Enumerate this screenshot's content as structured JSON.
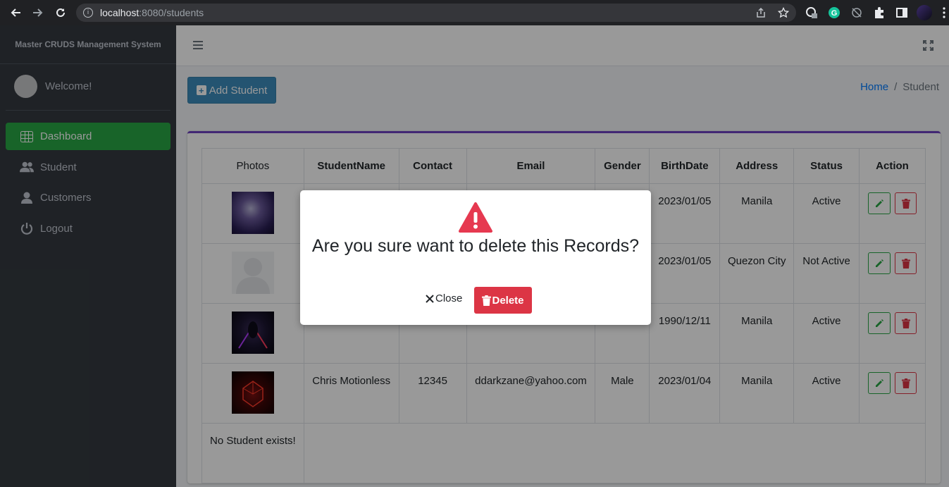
{
  "browser": {
    "url_host": "localhost",
    "url_rest": ":8080/students"
  },
  "sidebar": {
    "brand": "Master CRUDS Management System",
    "welcome": "Welcome!",
    "items": [
      {
        "label": "Dashboard",
        "icon": "table-icon",
        "active": true
      },
      {
        "label": "Student",
        "icon": "users-icon",
        "active": false
      },
      {
        "label": "Customers",
        "icon": "user-icon",
        "active": false
      },
      {
        "label": "Logout",
        "icon": "power-icon",
        "active": false
      }
    ]
  },
  "header": {
    "add_button": "Add Student",
    "breadcrumb_home": "Home",
    "breadcrumb_sep": "/",
    "breadcrumb_current": "Student"
  },
  "table": {
    "headers": [
      "Photos",
      "StudentName",
      "Contact",
      "Email",
      "Gender",
      "BirthDate",
      "Address",
      "Status",
      "Action"
    ],
    "rows": [
      {
        "photo": "dark-figure-photo",
        "name": "",
        "contact": "",
        "email": "",
        "gender": "",
        "birthdate": "2023/01/05",
        "address": "Manila",
        "status": "Active"
      },
      {
        "photo": "default-avatar",
        "name": "",
        "contact": "",
        "email": "",
        "gender": "",
        "birthdate": "2023/01/05",
        "address": "Quezon City",
        "status": "Not Active"
      },
      {
        "photo": "sith-figure-photo",
        "name": "",
        "contact": "",
        "email": "",
        "gender": "",
        "birthdate": "1990/12/11",
        "address": "Manila",
        "status": "Active"
      },
      {
        "photo": "red-cube-photo",
        "name": "Chris Motionless",
        "contact": "12345",
        "email": "ddarkzane@yahoo.com",
        "gender": "Male",
        "birthdate": "2023/01/04",
        "address": "Manila",
        "status": "Active"
      }
    ],
    "empty_text": "No Student exists!"
  },
  "modal": {
    "message": "Are you sure want to delete this Records?",
    "close_label": "Close",
    "delete_label": "Delete"
  },
  "colors": {
    "sidebar_bg": "#343a40",
    "active_green": "#28a745",
    "add_blue": "#3c8dbc",
    "danger": "#dc3545",
    "card_accent": "#6f42c1"
  }
}
